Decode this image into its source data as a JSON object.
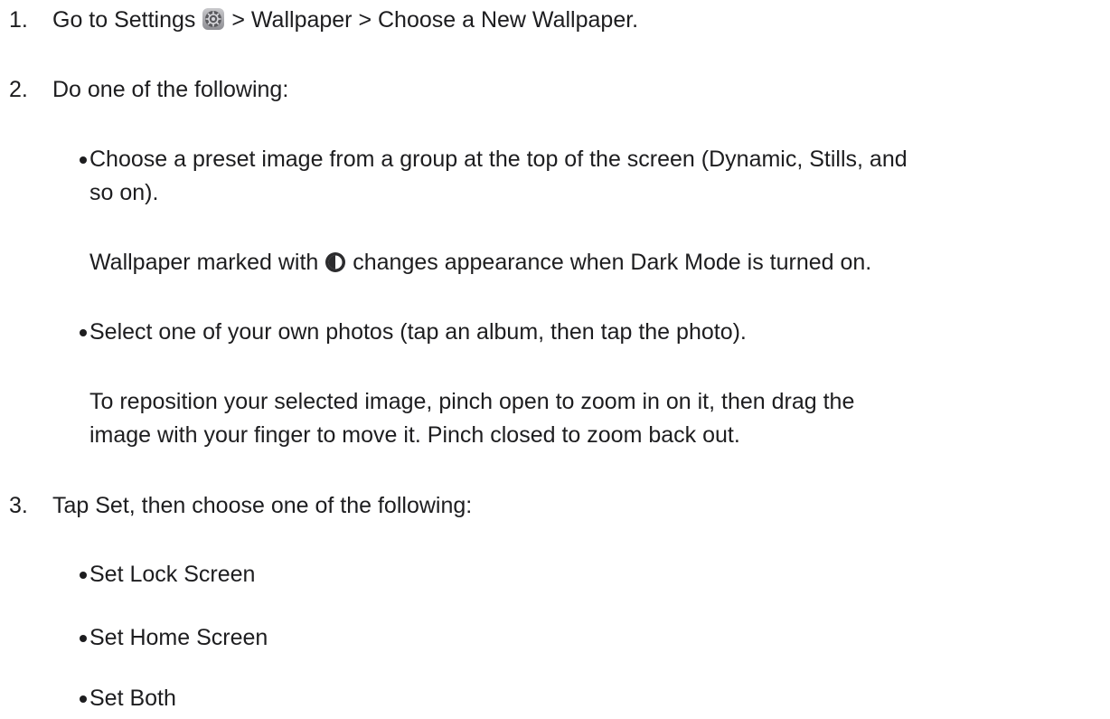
{
  "steps": [
    {
      "number": "1.",
      "prefix": "Go to Settings",
      "suffix": "> Wallpaper > Choose a New Wallpaper.",
      "icon": "settings-gear-icon"
    },
    {
      "number": "2.",
      "text": "Do one of the following:"
    },
    {
      "number": "3.",
      "text": "Tap Set, then choose one of the following:"
    }
  ],
  "step2_options": [
    {
      "line1": "Choose a preset image from a group at the top of the screen (Dynamic, Stills, and",
      "line2": "so on).",
      "note_prefix": "Wallpaper marked with",
      "note_suffix": "changes appearance when Dark Mode is turned on.",
      "note_icon": "dark-mode-icon"
    },
    {
      "line1": "Select one of your own photos (tap an album, then tap the photo).",
      "note_line1": "To reposition your selected image, pinch open to zoom in on it, then drag the",
      "note_line2": "image with your finger to move it. Pinch closed to zoom back out."
    }
  ],
  "step3_options": [
    "Set Lock Screen",
    "Set Home Screen",
    "Set Both"
  ]
}
